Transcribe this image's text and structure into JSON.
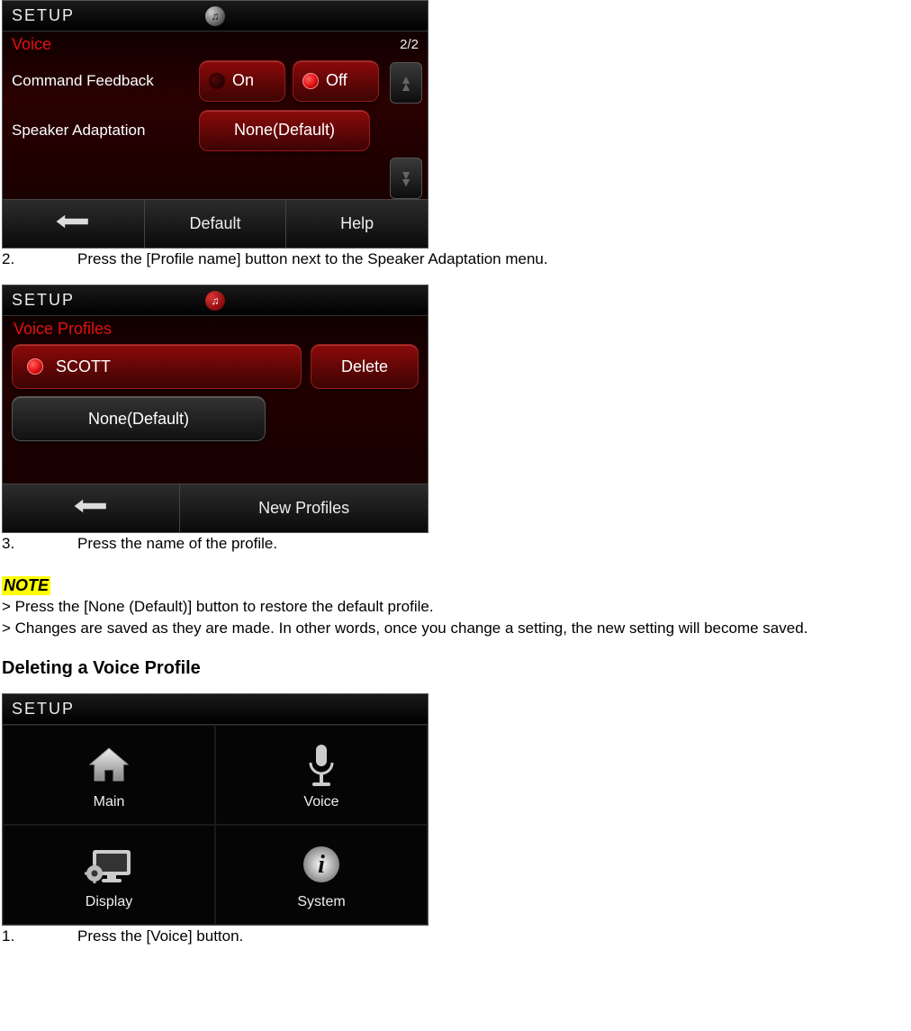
{
  "screen1": {
    "topbar_title": "SETUP",
    "section_label": "Voice",
    "page_indicator": "2/2",
    "rows": {
      "command_feedback_label": "Command Feedback",
      "on_label": "On",
      "off_label": "Off",
      "speaker_adaptation_label": "Speaker Adaptation",
      "profile_button_label": "None(Default)"
    },
    "bottombar": {
      "default_label": "Default",
      "help_label": "Help"
    }
  },
  "step2_text": "Press the [Profile name] button next to the Speaker Adaptation menu.",
  "step2_num": "2.",
  "screen2": {
    "topbar_title": "SETUP",
    "subtitle": "Voice Profiles",
    "profile_name": "SCOTT",
    "delete_label": "Delete",
    "none_label": "None(Default)",
    "bottombar": {
      "new_profiles_label": "New Profiles"
    }
  },
  "step3_num": "3.",
  "step3_text": "Press the name of the profile.",
  "note": {
    "header": "NOTE",
    "line1": "> Press the [None (Default)] button to restore the default profile.",
    "line2": "> Changes are saved as they are made. In other words, once you change a setting, the new setting will become saved."
  },
  "section_heading": "Deleting a Voice Profile",
  "screen3": {
    "topbar_title": "SETUP",
    "cells": {
      "main": "Main",
      "voice": "Voice",
      "display": "Display",
      "system": "System"
    }
  },
  "step1_num": "1.",
  "step1_text": "Press the [Voice] button."
}
